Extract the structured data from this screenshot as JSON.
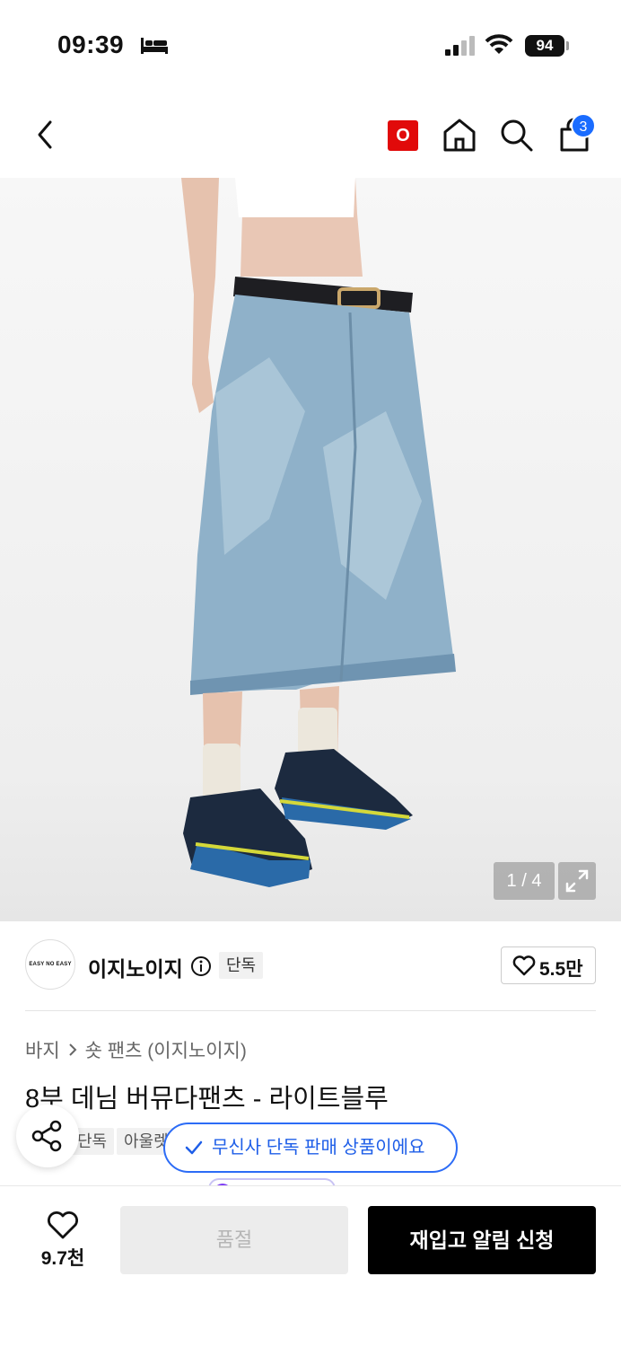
{
  "status_bar": {
    "time": "09:39",
    "battery": "94"
  },
  "nav": {
    "o_badge": "O",
    "cart_count": "3"
  },
  "gallery": {
    "counter": "1 / 4"
  },
  "brand": {
    "logo_text": "EASY NO EASY",
    "name": "이지노이지",
    "exclusive_tag": "단독",
    "likes": "5.5만"
  },
  "breadcrumb": {
    "category": "바지",
    "sub_category": "숏 팬츠 (이지노이지)"
  },
  "product": {
    "title": "8부 데님 버뮤다팬츠 - 라이트블루"
  },
  "tags": [
    "단독",
    "아울렛"
  ],
  "toast": {
    "text": "무신사 단독 판매 상품이에요"
  },
  "bottom_bar": {
    "wish_count": "9.7천",
    "soldout_label": "품절",
    "restock_label": "재입고 알림 신청"
  },
  "colors": {
    "accent_blue": "#2c6cf6",
    "brand_red": "#e10a0a",
    "badge_blue": "#1a6cff"
  }
}
